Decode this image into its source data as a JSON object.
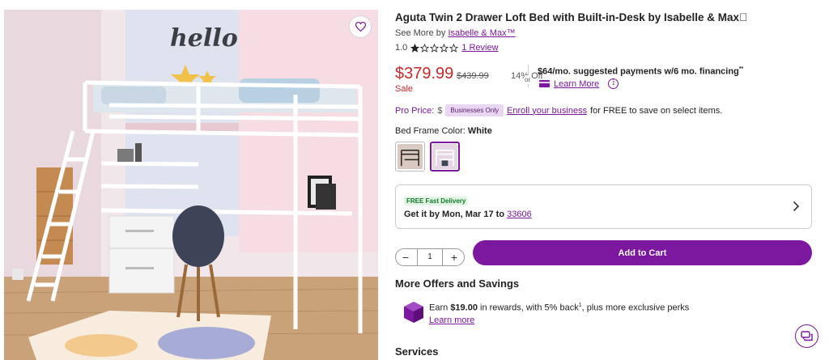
{
  "product": {
    "title": "Aguta Twin 2 Drawer Loft Bed with Built-in-Desk by Isabelle & Max\u0000",
    "see_more_prefix": "See More by",
    "brand": "Isabelle & Max™",
    "rating_value": "1.0",
    "rating_stars": 1,
    "rating_max": 5,
    "review_link": "1 Review",
    "image_wall_text": "hello"
  },
  "pricing": {
    "price": "$379.99",
    "was_price": "$439.99",
    "discount": "14% Off",
    "sale_label": "Sale",
    "or_label": "or",
    "financing": "$64/mo. suggested payments w/6 mo. financing",
    "financing_mark": "**",
    "learn_more": "Learn More",
    "info_glyph": "i"
  },
  "pro": {
    "label": "Pro Price:",
    "dollar_stub": "$",
    "badge": "Businesses Only",
    "enroll_link": "Enroll your business",
    "suffix": "for FREE to save on select items."
  },
  "color": {
    "label": "Bed Frame Color:",
    "selected": "White",
    "swatches": [
      {
        "name": "Black",
        "selected": false
      },
      {
        "name": "White",
        "selected": true
      }
    ]
  },
  "delivery": {
    "tag": "FREE Fast Delivery",
    "text": "Get it by Mon, Mar 17 to",
    "zip": "33606"
  },
  "cart": {
    "quantity": "1",
    "minus": "−",
    "plus": "+",
    "add_label": "Add to Cart"
  },
  "offers": {
    "heading": "More Offers and Savings",
    "reward_prefix": "Earn",
    "reward_amount": "$19.00",
    "reward_mid": "in rewards, with 5% back",
    "reward_mark": "1",
    "reward_suffix": ", plus more exclusive perks",
    "learn_more": "Learn more"
  },
  "services": {
    "heading": "Services"
  },
  "colors": {
    "accent": "#7b189f",
    "sale_red": "#c52a2a",
    "badge_bg": "#e9d6f2"
  }
}
